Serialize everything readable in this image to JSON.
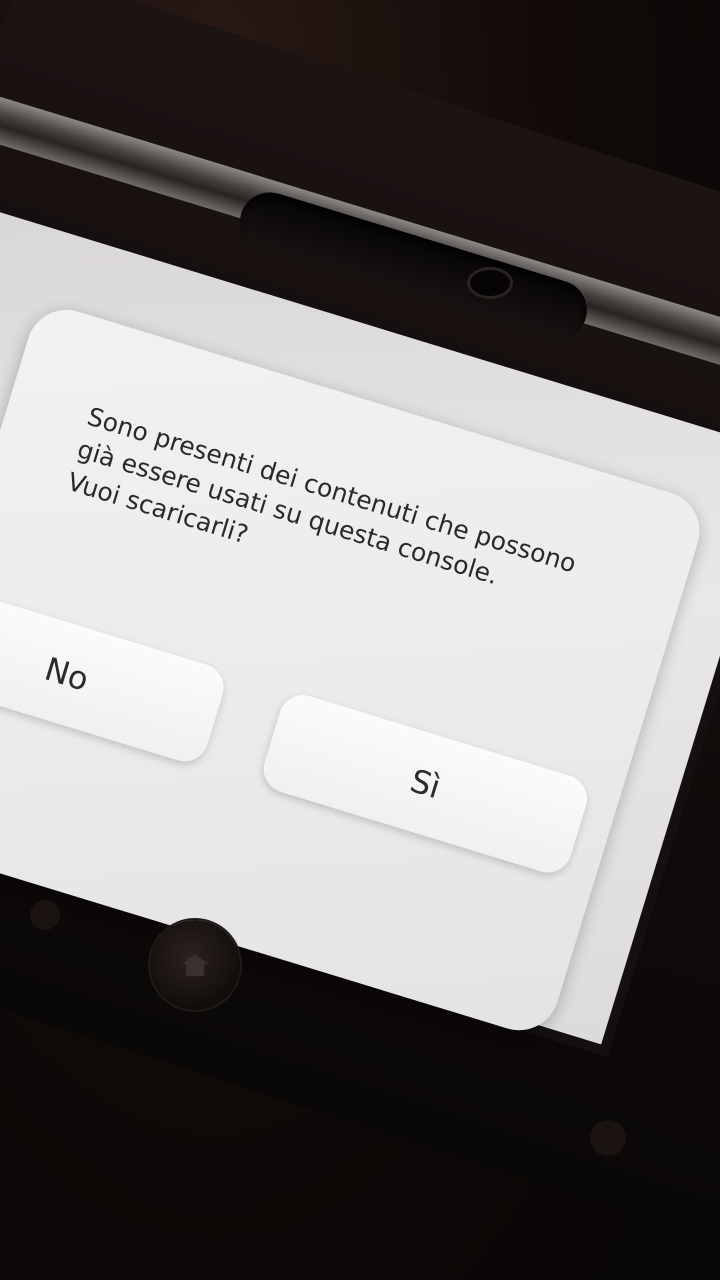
{
  "dialog": {
    "message": "Sono presenti dei contenuti che possono\ngià essere usati su questa console.\nVuoi scaricarli?",
    "buttons": {
      "no": "No",
      "yes": "Sì"
    }
  },
  "colors": {
    "dialog_background": "#efeeee",
    "button_background": "#f7f7f7",
    "text": "#2a2828",
    "device_body": "#120c0b"
  },
  "icons": {
    "home_button": "home-icon"
  }
}
